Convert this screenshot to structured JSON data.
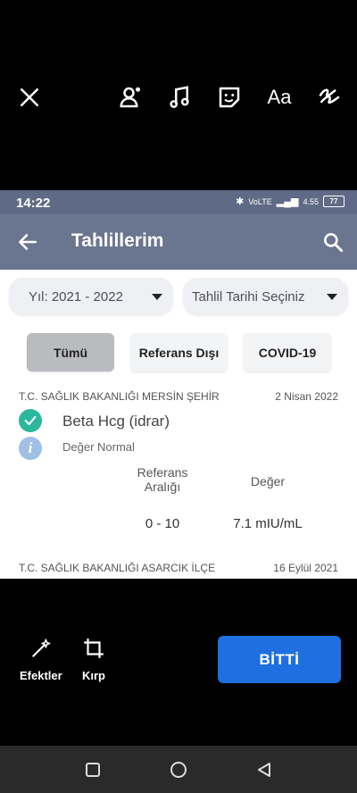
{
  "editor": {
    "top_icons": [
      "close-icon",
      "tag-person-icon",
      "music-icon",
      "sticker-icon",
      "text-icon",
      "draw-icon"
    ],
    "text_tool_label": "Aa",
    "effects_label": "Efektler",
    "crop_label": "Kırp",
    "done_label": "BİTTİ"
  },
  "status_bar": {
    "time": "14:22",
    "network": "4.55",
    "battery": "77"
  },
  "app": {
    "title": "Tahlillerim",
    "filters": {
      "year": "Yıl: 2021 - 2022",
      "date": "Tahlil Tarihi Seçiniz"
    },
    "tabs": [
      {
        "label": "Tümü",
        "active": true
      },
      {
        "label": "Referans Dışı",
        "active": false
      },
      {
        "label": "COVID-19",
        "active": false
      }
    ],
    "results": [
      {
        "institution": "T.C. SAĞLIK BAKANLIĞI MERSİN ŞEHİR",
        "date": "2 Nisan 2022",
        "test": "Beta Hcg (idrar)",
        "status": "Değer Normal",
        "ref_label": "Referans Aralığı",
        "value_label": "Değer",
        "ref_range": "0 - 10",
        "value": "7.1 mIU/mL"
      },
      {
        "institution": "T.C. SAĞLIK BAKANLIĞI ASARCIK İLÇE",
        "date": "16 Eylül 2021"
      }
    ]
  },
  "colors": {
    "header": "#6a7590",
    "done_button": "#1f6fe0",
    "check": "#2bb89a",
    "info": "#9fc0e3"
  }
}
